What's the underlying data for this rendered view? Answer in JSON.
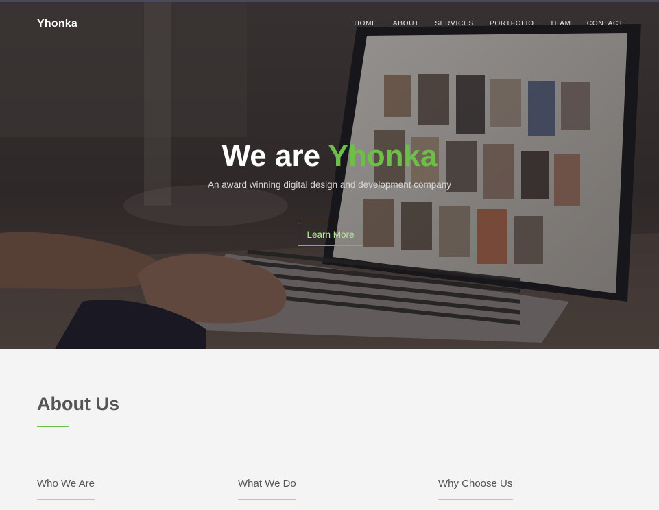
{
  "brand": "Yhonka",
  "nav": [
    "HOME",
    "ABOUT",
    "SERVICES",
    "PORTFOLIO",
    "TEAM",
    "CONTACT"
  ],
  "hero": {
    "title_prefix": "We are ",
    "title_accent": "Yhonka",
    "subtitle": "An award winning digital design and development company",
    "cta": "Learn More"
  },
  "about": {
    "title": "About Us",
    "columns": [
      "Who We Are",
      "What We Do",
      "Why Choose Us"
    ]
  },
  "colors": {
    "accent": "#6ebf4a",
    "text": "#555555",
    "background": "#f4f4f4"
  }
}
